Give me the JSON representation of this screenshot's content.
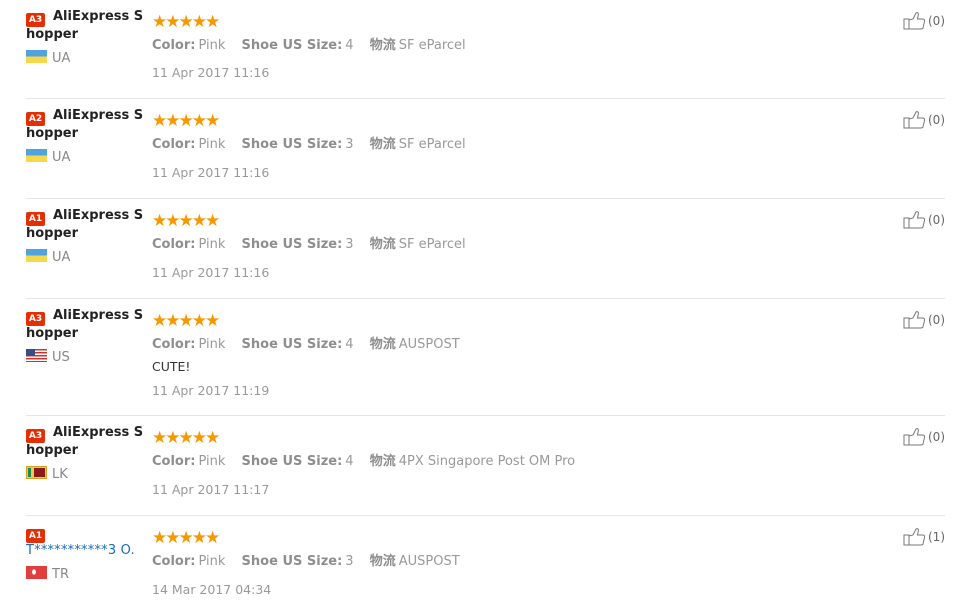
{
  "reviews": [
    {
      "badge": "A3",
      "name": "AliExpress Shopper",
      "country": "UA",
      "flag": "ua",
      "stars": 5,
      "color_label": "Color:",
      "color": "Pink",
      "size_label": "Shoe US Size:",
      "size": "4",
      "logistics_label": "物流",
      "logistics": "SF eParcel",
      "feedback": "",
      "date": "11 Apr 2017 11:16",
      "likes": "(0)"
    },
    {
      "badge": "A2",
      "name": "AliExpress Shopper",
      "country": "UA",
      "flag": "ua",
      "stars": 5,
      "color_label": "Color:",
      "color": "Pink",
      "size_label": "Shoe US Size:",
      "size": "3",
      "logistics_label": "物流",
      "logistics": "SF eParcel",
      "feedback": "",
      "date": "11 Apr 2017 11:16",
      "likes": "(0)"
    },
    {
      "badge": "A1",
      "name": "AliExpress Shopper",
      "country": "UA",
      "flag": "ua",
      "stars": 5,
      "color_label": "Color:",
      "color": "Pink",
      "size_label": "Shoe US Size:",
      "size": "3",
      "logistics_label": "物流",
      "logistics": "SF eParcel",
      "feedback": "",
      "date": "11 Apr 2017 11:16",
      "likes": "(0)"
    },
    {
      "badge": "A3",
      "name": "AliExpress Shopper",
      "country": "US",
      "flag": "us",
      "stars": 5,
      "color_label": "Color:",
      "color": "Pink",
      "size_label": "Shoe US Size:",
      "size": "4",
      "logistics_label": "物流",
      "logistics": "AUSPOST",
      "feedback": "CUTE!",
      "date": "11 Apr 2017 11:19",
      "likes": "(0)"
    },
    {
      "badge": "A3",
      "name": "AliExpress Shopper",
      "country": "LK",
      "flag": "lk",
      "stars": 5,
      "color_label": "Color:",
      "color": "Pink",
      "size_label": "Shoe US Size:",
      "size": "4",
      "logistics_label": "物流",
      "logistics": "4PX Singapore Post OM Pro",
      "feedback": "",
      "date": "11 Apr 2017 11:17",
      "likes": "(0)"
    },
    {
      "badge": "A1",
      "name": "T***********3 O.",
      "country": "TR",
      "flag": "tr",
      "stars": 5,
      "color_label": "Color:",
      "color": "Pink",
      "size_label": "Shoe US Size:",
      "size": "3",
      "logistics_label": "物流",
      "logistics": "AUSPOST",
      "feedback": "",
      "date": "14 Mar 2017 04:34",
      "likes": "(1)"
    }
  ],
  "colors": {
    "star": "#f79800",
    "badge": "#e62e04",
    "link": "#1a6cb8"
  },
  "icons": {
    "like": "thumbs-up-icon",
    "star": "star-icon"
  }
}
